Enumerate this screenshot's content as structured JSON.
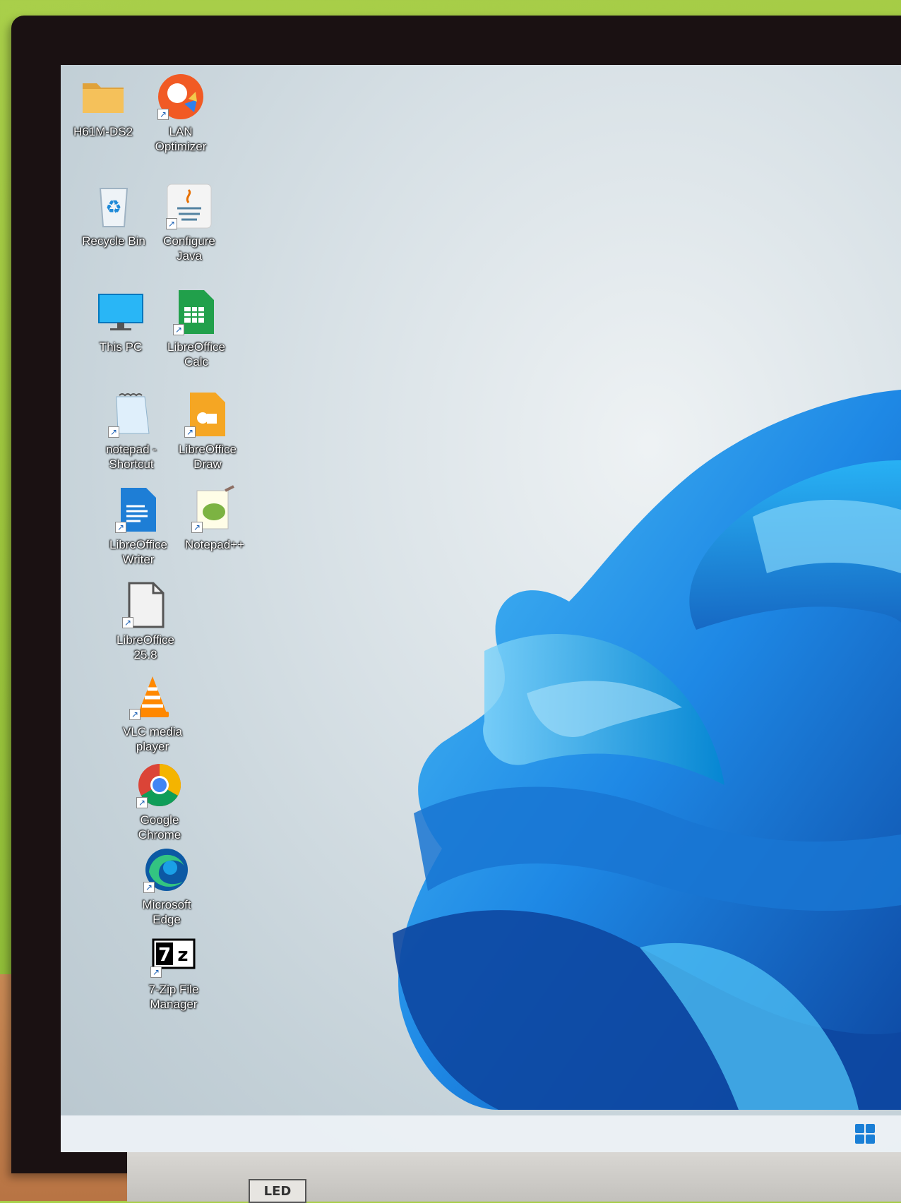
{
  "desktop": {
    "icons": [
      {
        "label": "H61M-DS2",
        "icon": "folder-icon"
      },
      {
        "label": "LAN\nOptimizer",
        "icon": "lan-optimizer-icon"
      },
      {
        "label": "Recycle Bin",
        "icon": "recycle-bin-icon"
      },
      {
        "label": "Configure\nJava",
        "icon": "java-icon"
      },
      {
        "label": "This PC",
        "icon": "monitor-icon"
      },
      {
        "label": "LibreOffice\nCalc",
        "icon": "libreoffice-calc-icon"
      },
      {
        "label": "notepad -\nShortcut",
        "icon": "notepad-icon"
      },
      {
        "label": "LibreOffice\nDraw",
        "icon": "libreoffice-draw-icon"
      },
      {
        "label": "LibreOffice\nWriter",
        "icon": "libreoffice-writer-icon"
      },
      {
        "label": "Notepad++",
        "icon": "notepad-plus-plus-icon"
      },
      {
        "label": "LibreOffice\n25.8",
        "icon": "libreoffice-icon"
      },
      {
        "label": "VLC media\nplayer",
        "icon": "vlc-icon"
      },
      {
        "label": "Google\nChrome",
        "icon": "chrome-icon"
      },
      {
        "label": "Microsoft\nEdge",
        "icon": "edge-icon"
      },
      {
        "label": "7-Zip File\nManager",
        "icon": "7zip-icon"
      }
    ]
  },
  "monitor": {
    "labels": [
      "LED"
    ]
  },
  "colors": {
    "accent": "#1a7fd6",
    "bloom_light": "#3bb4f2",
    "bloom_dark": "#0a3fc9"
  }
}
